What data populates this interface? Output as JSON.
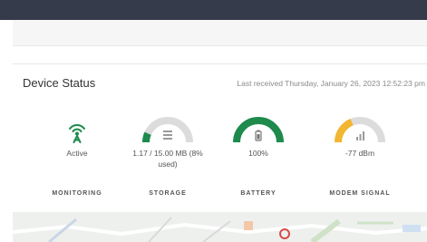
{
  "status_card": {
    "title": "Device Status",
    "last_received": "Last received Thursday, January 26, 2023 12:52:23 pm"
  },
  "tiles": [
    {
      "icon": "antenna-icon",
      "value": "Active",
      "label": "MONITORING",
      "color": "#1e8a4c"
    },
    {
      "icon": "storage-icon",
      "value": "1.17 / 15.00 MB (8% used)",
      "label": "STORAGE",
      "fill": 0.08,
      "color": "#1e8a4c"
    },
    {
      "icon": "battery-icon",
      "value": "100%",
      "label": "BATTERY",
      "fill": 1.0,
      "color": "#1e8a4c"
    },
    {
      "icon": "signal-icon",
      "value": "-77 dBm",
      "label": "MODEM SIGNAL",
      "fill": 0.28,
      "color": "#f2b630"
    }
  ],
  "colors": {
    "header_bar": "#353b4a",
    "gauge_track": "#dcdcdc",
    "ok_green": "#1e8a4c",
    "warn_yellow": "#f2b630"
  }
}
